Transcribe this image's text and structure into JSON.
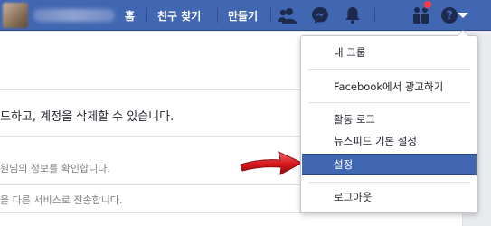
{
  "topbar": {
    "nav": {
      "home_label": "홈",
      "find_friends_label": "친구 찾기",
      "create_label": "만들기"
    },
    "icons": [
      "friends-icon",
      "messenger-icon",
      "notifications-icon",
      "quick-help-people-icon",
      "help-icon",
      "account-menu-caret-icon"
    ],
    "accent_color": "#4267b2",
    "badge_color": "#fa3e3e"
  },
  "page": {
    "main_text": "드하고, 계정을 삭제할 수 있습니다.",
    "rows": [
      "원님의 정보를 확인합니다.",
      "을 다른 서비스로 전송합니다."
    ]
  },
  "dropdown": {
    "items": [
      {
        "label": "내 그룹"
      },
      {
        "label": "Facebook에서 광고하기"
      },
      {
        "label": "활동 로그"
      },
      {
        "label": "뉴스피드 기본 설정"
      },
      {
        "label": "설정",
        "active": true
      },
      {
        "label": "로그아웃"
      }
    ],
    "highlight_color": "#4267b2"
  }
}
